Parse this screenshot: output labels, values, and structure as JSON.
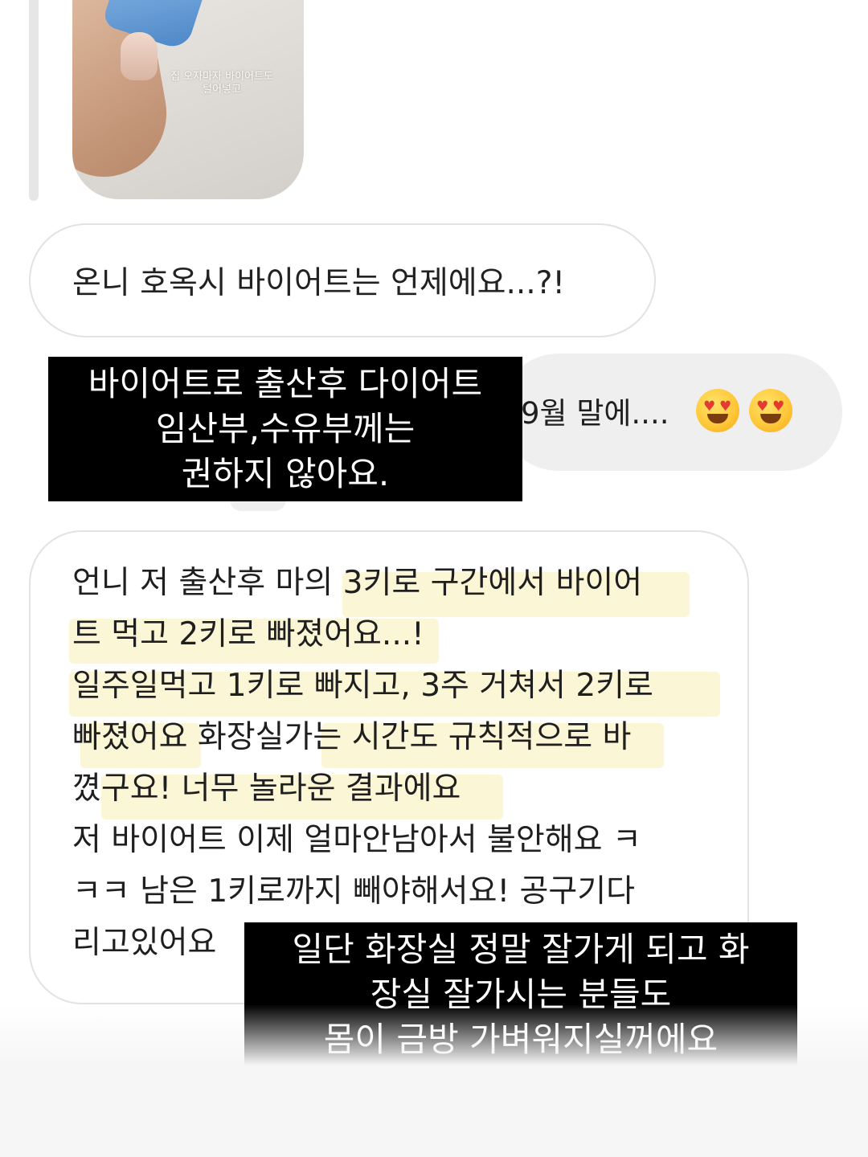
{
  "story_thumbnail": {
    "caption": "집 오자마자 바이어트도\n털어넣고"
  },
  "messages": {
    "question": "온니 호옥시 바이어트는 언제에요...?!",
    "reply": "9월 말에....",
    "reply_emoji": "heart-eyes-emoji",
    "review": "언니 저 출산후 마의 3키로 구간에서 바이어\n트 먹고 2키로 빠졌어요...!\n일주일먹고 1키로 빠지고, 3주 거쳐서 2키로\n빠졌어요 화장실가는 시간도 규칙적으로 바\n꼈구요! 너무 놀라운 결과에요\n저 바이어트 이제 얼마안남아서 불안해요 ㅋ\nㅋㅋ 남은 1키로까지 빼야해서요! 공구기다\n리고있어요"
  },
  "overlays": {
    "top": "바이어트로 출산후 다이어트\n임산부,수유부께는\n권하지 않아요.",
    "bottom": "일단 화장실 정말 잘가게 되고 화\n장실 잘가시는 분들도\n몸이 금방 가벼워지실꺼에요"
  },
  "colors": {
    "overlay_bg": "#000000",
    "reply_bubble": "#efefef",
    "highlight": "#f8efb4"
  }
}
